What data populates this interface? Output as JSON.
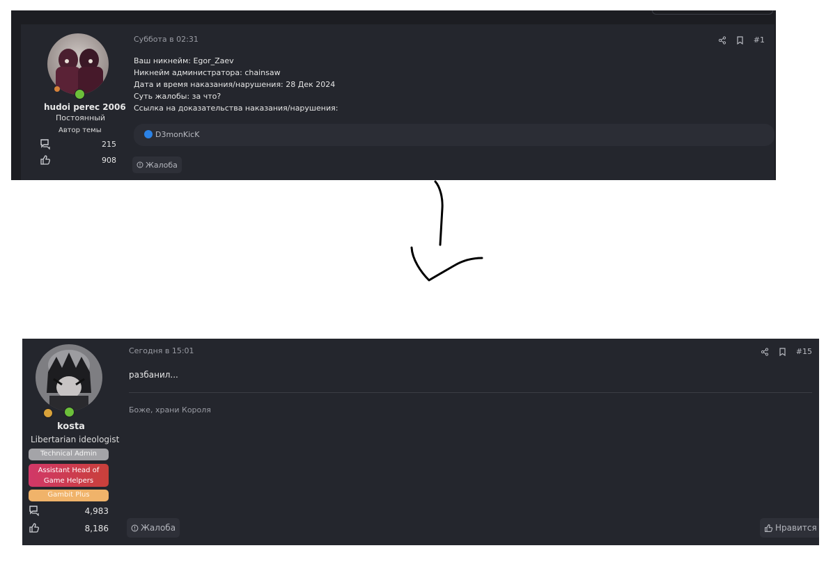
{
  "post1": {
    "username": "hudoi perec 2006",
    "user_title": "Постоянный",
    "role": "Автор темы",
    "stats": {
      "messages": "215",
      "reactions": "908"
    },
    "date": "Суббота в 02:31",
    "post_number": "#1",
    "body": [
      "Ваш никнейм: Egor_Zaev",
      "Никнейм администратора: chainsaw",
      "Дата и время наказания/нарушения: 28 Дек 2024",
      "Суть жалобы: за что?",
      "Ссылка на доказательства наказания/нарушения:"
    ],
    "reaction_user": "D3monKicK",
    "report_label": "Жалоба"
  },
  "post2": {
    "username": "kosta",
    "user_title": "Libertarian ideologist",
    "badges": [
      "Technical Admin",
      "Assistant Head of Game Helpers",
      "Gambit Plus"
    ],
    "badge_colors": [
      "#a4a4a8",
      "#cf3a52",
      "#f0b36a"
    ],
    "stats": {
      "messages": "4,983",
      "reactions": "8,186"
    },
    "date": "Сегодня в 15:01",
    "post_number": "#15",
    "body": "разбанил...",
    "signature": "Боже, храни Короля",
    "report_label": "Жалоба",
    "like_label": "Нравится"
  },
  "colors": {
    "post_bg": "#24262d",
    "page_bg": "#1c1d22",
    "online": "#6cbf3a",
    "like_blue": "#2b82e6"
  },
  "icons": [
    "share-icon",
    "bookmark-icon",
    "messages-icon",
    "thumbs-up-icon",
    "report-icon",
    "hand-drawn-arrow"
  ]
}
